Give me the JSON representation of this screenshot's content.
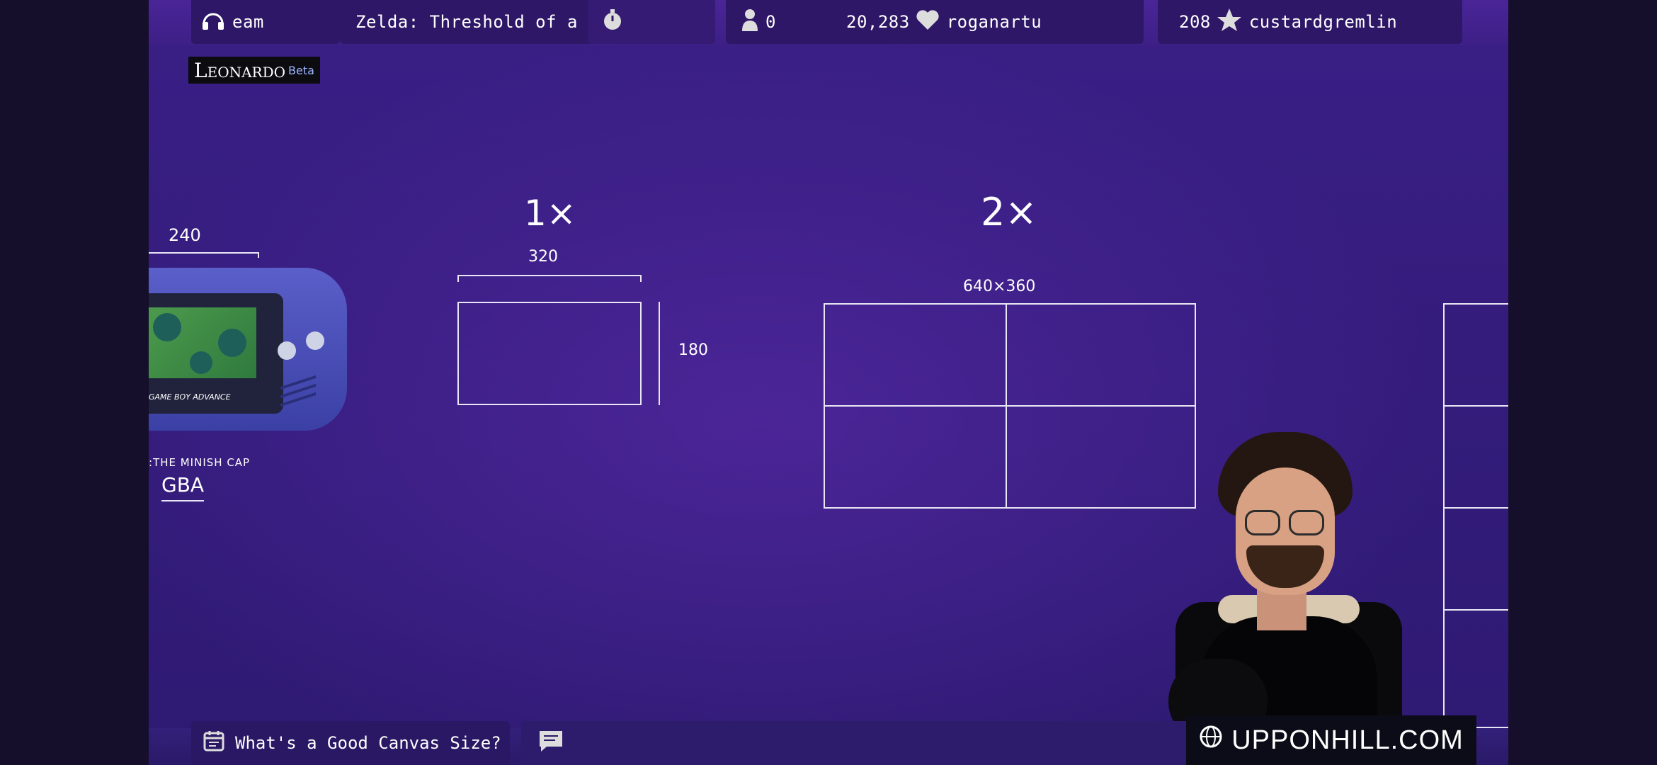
{
  "topbar": {
    "now_playing": "eam",
    "game_title": "Zelda: Threshold of a Dr",
    "viewer_count": "0",
    "follower_count": "20,283",
    "latest_follower": "roganartu",
    "sub_count": "208",
    "latest_sub": "custardgremlin"
  },
  "logo": {
    "name": "Leonardo",
    "tag": "Beta"
  },
  "whiteboard": {
    "gba_width": "240",
    "gba_caption": ":THE MINISH CAP",
    "gba_label": "GBA",
    "device_label": "GAME BOY ADVANCE",
    "scale_1x_label": "1×",
    "scale_1x_width": "320",
    "scale_1x_height": "180",
    "scale_2x_label": "2×",
    "scale_2x_size": "640×360"
  },
  "bottombar": {
    "topic": "What's a Good Canvas Size?",
    "website": "UPPONHILL.COM"
  },
  "colors": {
    "background": "#3a1f86",
    "chip": "#2d1766",
    "ink": "#e8e6f5"
  }
}
